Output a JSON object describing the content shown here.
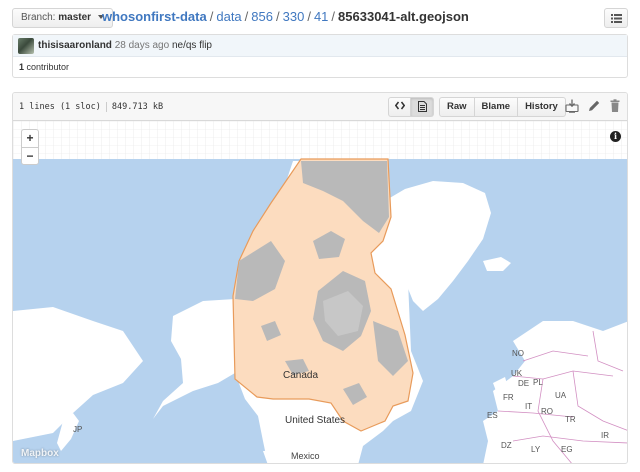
{
  "topbar": {
    "branch_prefix": "Branch:",
    "branch_name": "master",
    "repo": "whosonfirst-data",
    "path": [
      "data",
      "856",
      "330",
      "41"
    ],
    "filename": "85633041-alt.geojson"
  },
  "commit": {
    "author": "thisisaaronland",
    "ago": "28 days ago",
    "message": "ne/qs flip",
    "contributors_count": "1",
    "contributors_label": "contributor"
  },
  "file": {
    "lines": "1 lines (1 sloc)",
    "size": "849.713 kB",
    "actions": {
      "raw": "Raw",
      "blame": "Blame",
      "history": "History"
    }
  },
  "map": {
    "zoom_in": "+",
    "zoom_out": "−",
    "info": "i",
    "attribution": "Mapbox",
    "labels": {
      "canada": "Canada",
      "united_states": "United States",
      "mexico": "Mexico",
      "jp": "JP",
      "no": "NO",
      "ua": "UA",
      "fr": "FR",
      "es": "ES",
      "pl": "PL",
      "de": "DE",
      "dz": "DZ",
      "ly": "LY",
      "eg": "EG",
      "tr": "TR",
      "ir": "IR",
      "it": "IT",
      "ro": "RO",
      "uk": "UK"
    }
  },
  "colors": {
    "link": "#4078c0",
    "ocean": "#b6d2ee",
    "land": "#ffffff",
    "selected_fill": "#fcdcbf",
    "selected_stroke": "#e89b5b",
    "water_overlay": "#b9b9b9"
  }
}
